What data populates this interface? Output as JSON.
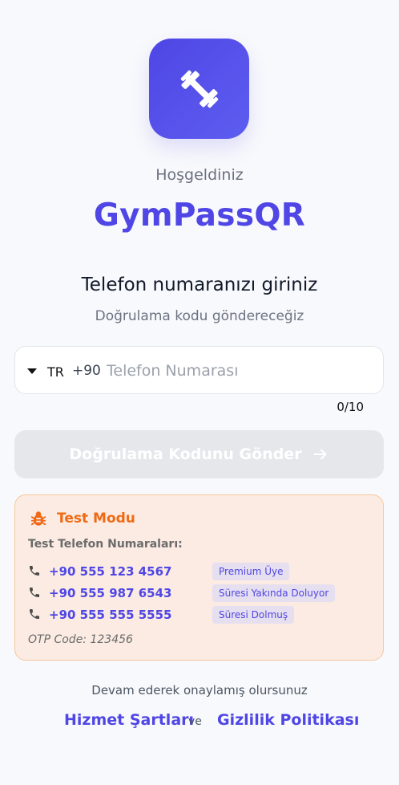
{
  "logo": {
    "icon": "dumbbell-icon",
    "bg_start": "#4f46e5",
    "bg_end": "#5d5df0"
  },
  "welcome": "Hoşgeldiniz",
  "app_title": "GymPassQR",
  "heading": "Telefon numaranızı giriniz",
  "subheading": "Doğrulama kodu göndereceğiz",
  "phone": {
    "country": "TR",
    "dial_code": "+90",
    "value": "",
    "placeholder": "Telefon Numarası",
    "counter": "0/10"
  },
  "send_button": {
    "label": "Doğrulama Kodunu Gönder",
    "icon": "arrow-right-icon",
    "disabled": true
  },
  "test_mode": {
    "title": "Test Modu",
    "icon": "bug-icon",
    "subtitle": "Test Telefon Numaraları:",
    "numbers": [
      {
        "number": "+90 555 123 4567",
        "badge": "Premium Üye"
      },
      {
        "number": "+90 555 987 6543",
        "badge": "Süresi Yakında Doluyor"
      },
      {
        "number": "+90 555 555 5555",
        "badge": "Süresi Dolmuş"
      }
    ],
    "otp": "OTP Code: 123456"
  },
  "footer": {
    "note": "Devam ederek onaylamış olursunuz",
    "terms_link": "Hizmet Şartları",
    "and": "ve",
    "privacy_link": "Gizlilik Politikası"
  },
  "colors": {
    "accent": "#4f46e5",
    "warning": "#f06a15",
    "card_bg": "#fbebe3"
  }
}
